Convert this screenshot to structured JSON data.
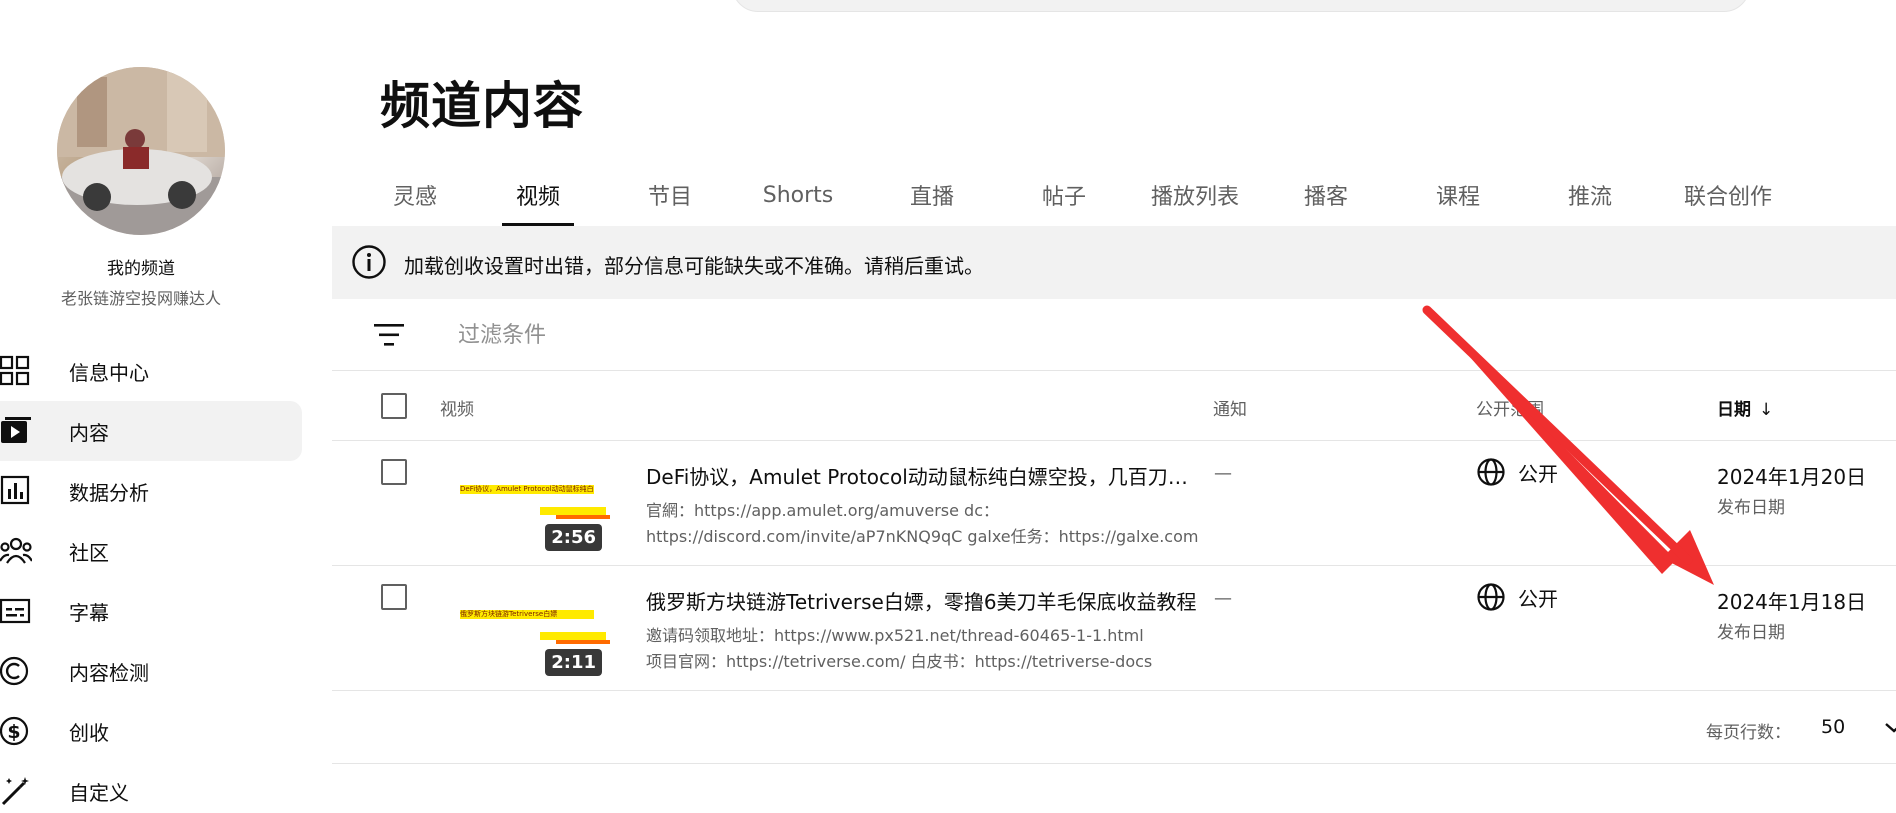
{
  "page": {
    "title": "频道内容"
  },
  "sidebar": {
    "channel_label": "我的频道",
    "channel_name": "老张链游空投网赚达人",
    "items": [
      {
        "label": "信息中心",
        "icon": "dashboard-icon",
        "active": false
      },
      {
        "label": "内容",
        "icon": "content-icon",
        "active": true
      },
      {
        "label": "数据分析",
        "icon": "analytics-icon",
        "active": false
      },
      {
        "label": "社区",
        "icon": "community-icon",
        "active": false
      },
      {
        "label": "字幕",
        "icon": "subtitles-icon",
        "active": false
      },
      {
        "label": "内容检测",
        "icon": "copyright-icon",
        "active": false
      },
      {
        "label": "创收",
        "icon": "monetization-icon",
        "active": false
      },
      {
        "label": "自定义",
        "icon": "customization-icon",
        "active": false
      }
    ]
  },
  "tabs": [
    {
      "label": "灵感",
      "active": false
    },
    {
      "label": "视频",
      "active": true
    },
    {
      "label": "节目",
      "active": false
    },
    {
      "label": "Shorts",
      "active": false
    },
    {
      "label": "直播",
      "active": false
    },
    {
      "label": "帖子",
      "active": false
    },
    {
      "label": "播放列表",
      "active": false
    },
    {
      "label": "播客",
      "active": false
    },
    {
      "label": "课程",
      "active": false
    },
    {
      "label": "推流",
      "active": false
    },
    {
      "label": "联合创作",
      "active": false
    }
  ],
  "banner": {
    "icon": "info-icon",
    "text": "加载创收设置时出错，部分信息可能缺失或不准确。请稍后重试。"
  },
  "filter": {
    "icon": "filter-icon",
    "placeholder": "过滤条件"
  },
  "table": {
    "headers": {
      "video": "视频",
      "notice": "通知",
      "visibility": "公开范围",
      "date": "日期",
      "date_sort": "↓"
    },
    "rows": [
      {
        "title": "DeFi协议，Amulet Protocol动动鼠标纯白嫖空投，几百刀到手，目前还未发币",
        "desc_line1": "官網：https://app.amulet.org/amuverse dc：",
        "desc_line2": "https://discord.com/invite/aP7nKNQ9qC galxe任务：https://galxe.com",
        "duration": "2:56",
        "thumb_text": "DeFi协议，Amulet Protocol动动鼠标纯白嫖空投",
        "notice": "—",
        "visibility": "公开",
        "date": "2024年1月20日",
        "date_sub": "发布日期"
      },
      {
        "title": "俄罗斯方块链游Tetriverse白嫖，零撸6美刀羊毛保底收益教程",
        "desc_line1": "邀请码领取地址：https://www.px521.net/thread-60465-1-1.html",
        "desc_line2": "项目官网：https://tetriverse.com/ 白皮书：https://tetriverse-docs",
        "duration": "2:11",
        "thumb_text": "俄罗斯方块链游Tetriverse白嫖",
        "notice": "—",
        "visibility": "公开",
        "date": "2024年1月18日",
        "date_sub": "发布日期"
      }
    ]
  },
  "pager": {
    "label": "每页行数：",
    "value": "50"
  },
  "colors": {
    "annotation_arrow": "#ef2f2f",
    "thumb_banner": "#ffea00"
  }
}
